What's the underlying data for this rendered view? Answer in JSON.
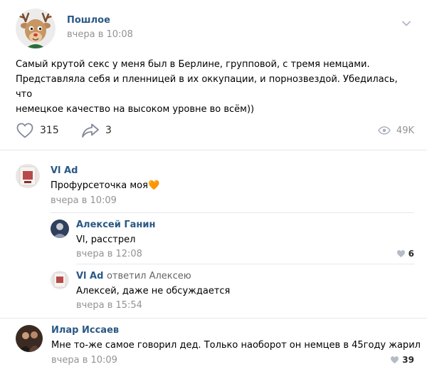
{
  "post": {
    "author": "Пошлое",
    "time": "вчера в 10:08",
    "text_lines": [
      "Самый крутой секс у меня был в Берлине, групповой, с тремя немцами.",
      "Представляла себя и пленницей в их оккупации, и порнозвездой. Убедилась, что",
      "немецкое качество на высоком уровне во всём))"
    ],
    "likes": "315",
    "shares": "3",
    "views": "49K"
  },
  "comments": [
    {
      "author": "Vl Ad",
      "text": "Профурсеточка моя",
      "emoji": "🧡",
      "time": "вчера в 10:09",
      "likes": ""
    },
    {
      "author": "Алексей Ганин",
      "text": "Vl, расстрел",
      "time": "вчера в 12:08",
      "likes": "6"
    },
    {
      "author": "Vl Ad",
      "replied": "ответил Алексею",
      "text": "Алексей, даже не обсуждается",
      "time": "вчера в 15:54",
      "likes": ""
    },
    {
      "author": "Илар Иссаев",
      "text": "Мне то-же самое говорил дед. Только наоборот он немцев в 45году жарил",
      "time": "вчера в 10:09",
      "likes": "39"
    }
  ],
  "colors": {
    "link": "#2a5885",
    "muted": "#939393",
    "divider": "#e7e8ec",
    "heart": "#f26b1d"
  },
  "icons": [
    "deer-avatar",
    "chevron-down-icon",
    "heart-icon",
    "share-icon",
    "eye-icon"
  ]
}
